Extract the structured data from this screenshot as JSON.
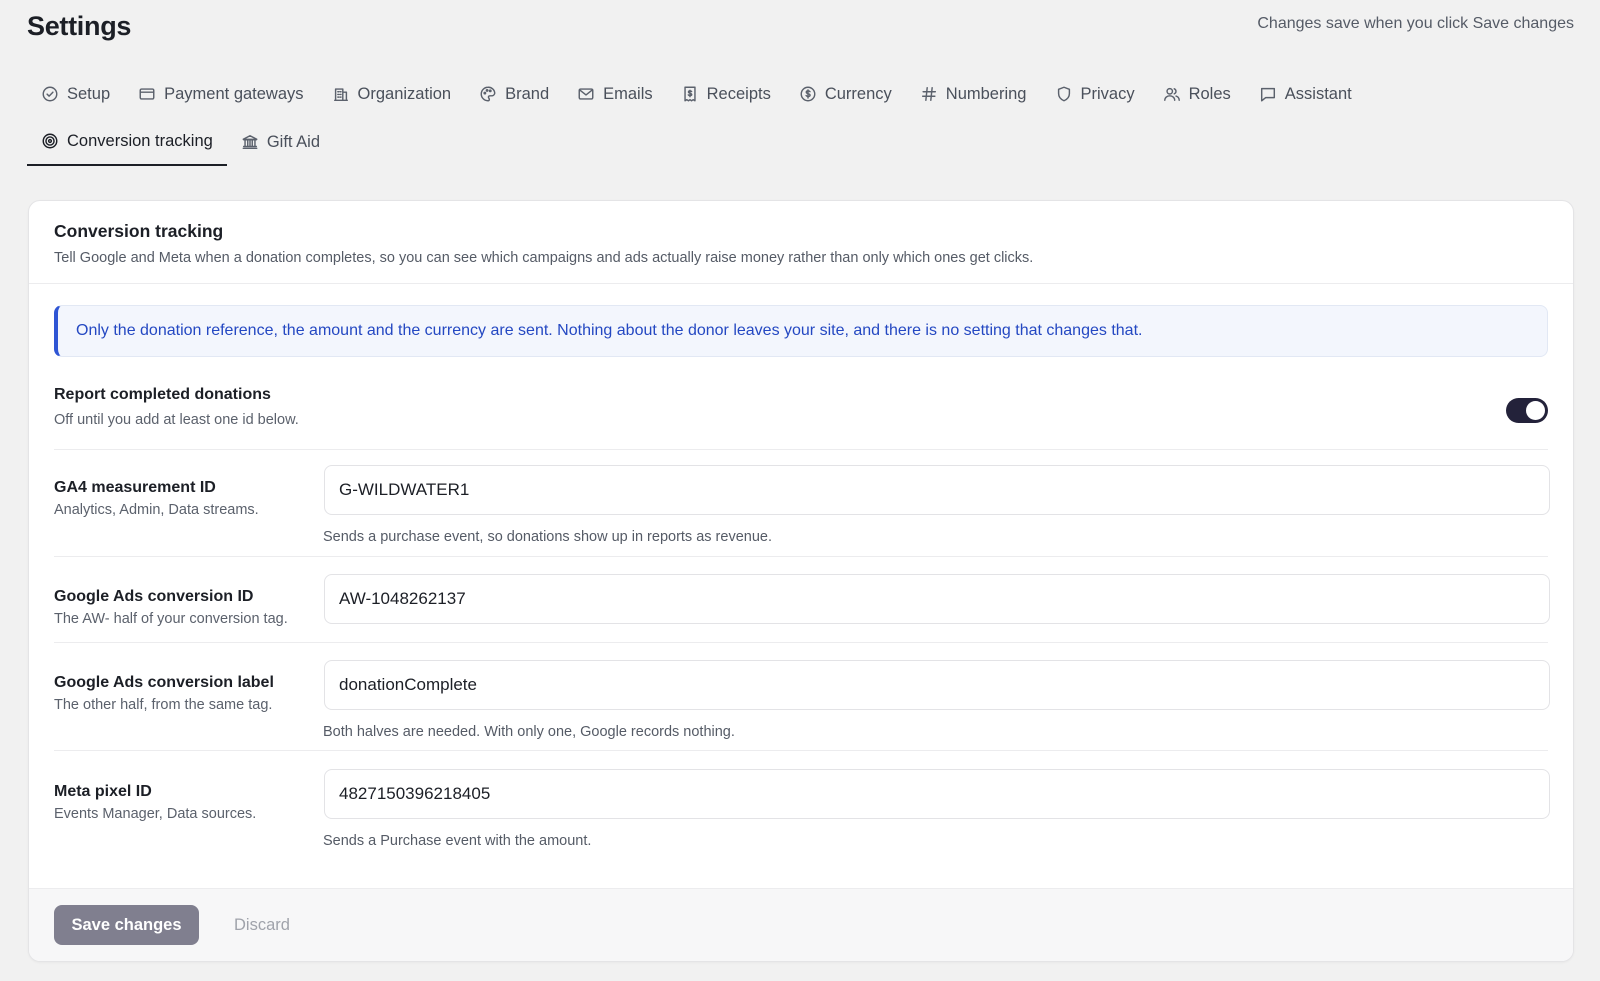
{
  "page": {
    "title": "Settings",
    "save_note": "Changes save when you click Save changes"
  },
  "tabs": [
    {
      "label": "Setup",
      "icon": "check-circle-icon"
    },
    {
      "label": "Payment gateways",
      "icon": "credit-card-icon"
    },
    {
      "label": "Organization",
      "icon": "building-icon"
    },
    {
      "label": "Brand",
      "icon": "palette-icon"
    },
    {
      "label": "Emails",
      "icon": "mail-icon"
    },
    {
      "label": "Receipts",
      "icon": "receipt-icon"
    },
    {
      "label": "Currency",
      "icon": "dollar-circle-icon"
    },
    {
      "label": "Numbering",
      "icon": "hash-icon"
    },
    {
      "label": "Privacy",
      "icon": "shield-icon"
    },
    {
      "label": "Roles",
      "icon": "users-icon"
    },
    {
      "label": "Assistant",
      "icon": "chat-bubble-icon"
    },
    {
      "label": "Conversion tracking",
      "icon": "target-icon",
      "active": true
    },
    {
      "label": "Gift Aid",
      "icon": "bank-icon"
    }
  ],
  "card": {
    "title": "Conversion tracking",
    "description": "Tell Google and Meta when a donation completes, so you can see which campaigns and ads actually raise money rather than only which ones get clicks.",
    "notice": "Only the donation reference, the amount and the currency are sent. Nothing about the donor leaves your site, and there is no setting that changes that.",
    "toggle": {
      "label": "Report completed donations",
      "help": "Off until you add at least one id below.",
      "on": true
    },
    "fields": {
      "ga4": {
        "label": "GA4 measurement ID",
        "help": "Analytics, Admin, Data streams.",
        "value": "G-WILDWATER1",
        "note": "Sends a purchase event, so donations show up in reports as revenue."
      },
      "ads_id": {
        "label": "Google Ads conversion ID",
        "help": "The AW- half of your conversion tag.",
        "value": "AW-1048262137"
      },
      "ads_label": {
        "label": "Google Ads conversion label",
        "help": "The other half, from the same tag.",
        "value": "donationComplete",
        "note": "Both halves are needed. With only one, Google records nothing."
      },
      "meta": {
        "label": "Meta pixel ID",
        "help": "Events Manager, Data sources.",
        "value": "4827150396218405",
        "note": "Sends a Purchase event with the amount."
      }
    },
    "footer": {
      "save_label": "Save changes",
      "discard_label": "Discard"
    }
  },
  "colors": {
    "accent": "#23223a",
    "notice_text": "#2448c2",
    "notice_border": "#2f55d4",
    "save_button": "#807f8f"
  }
}
